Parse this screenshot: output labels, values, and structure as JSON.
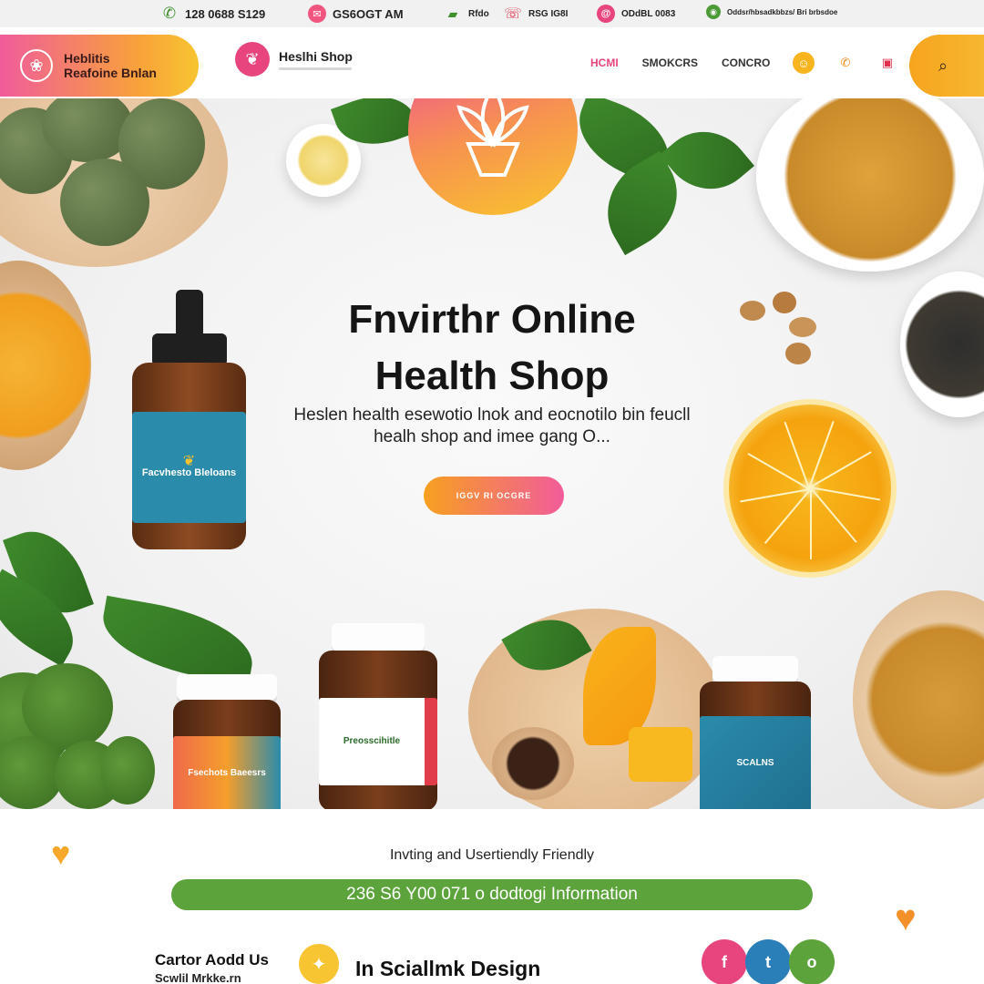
{
  "topbar": {
    "phone": "128 0688 S129",
    "email": "GS6OGT AM",
    "cart": "Rfdo",
    "call": "RSG IG8I",
    "mail": "ODdBL 0083",
    "note": "Oddsr/hbsadkbbzs/ Bri brbsdoe"
  },
  "header": {
    "brand_line1": "Heblitis",
    "brand_line2": "Reafoine Bnlan",
    "shop_name": "Heslhi Shop",
    "nav": [
      "HCMI",
      "SMOKCRS",
      "CONCRO"
    ],
    "colors": {
      "pink": "#e8457f",
      "orange": "#f7a41e",
      "yellow": "#f7c531",
      "green": "#5da33c"
    }
  },
  "hero": {
    "title_line1": "Fnvirthr Online",
    "title_line2": "Health Shop",
    "subtitle_line1": "Heslen health esewotio lnok and eocnotilo bin feucll",
    "subtitle_line2": "healh shop and imee gang O...",
    "cta": "IGGV RI OCGRE",
    "bottle_label": "Facvhesto Bleloans",
    "jar1_label": "Fsechots Baeesrs",
    "jar2_label": "Preosscihitle",
    "jar3_label": "SCALNS"
  },
  "bottom": {
    "tagline": "Invting and Usertiendly Friendly",
    "info": "236 S6 Y00 071 o dodtogi Information",
    "contact_line1": "Cartor Aodd Us",
    "contact_line2": "Scwlil Mrkke.rn",
    "social_title": "In  Sciallmk Design",
    "social": [
      "f",
      "t",
      "o"
    ]
  }
}
